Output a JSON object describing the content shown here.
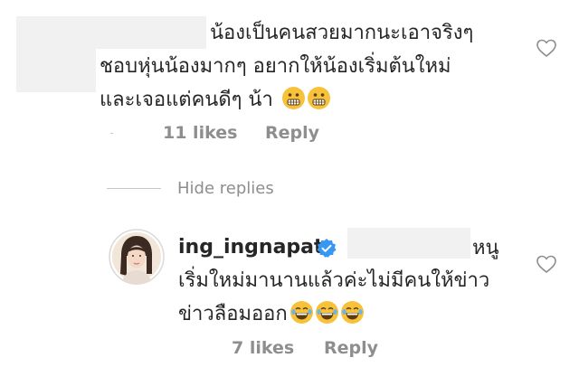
{
  "comment": {
    "line1": "น้องเป็นคนสวยมากนะเอาจริงๆ",
    "line2": "ชอบหุ่นน้องมากๆ  อยากให้น้องเริ่มต้นใหม่",
    "line3": "และเจอแต่คนดีๆ น้า",
    "likes": "11 likes",
    "reply_label": "Reply",
    "emojis": [
      "grimacing-face-emoji",
      "grimacing-face-emoji"
    ]
  },
  "hide_replies_label": "Hide replies",
  "reply": {
    "username": "ing_ingnapat",
    "verified": true,
    "line1_suffix": "หนู",
    "line2": "เริ่มใหม่มานานแล้วค่ะไม่มีคนให้ข่าว",
    "line3": "ข่าวลือมออก",
    "likes": "7 likes",
    "reply_label": "Reply",
    "emojis": [
      "laughing-tears-emoji",
      "laughing-tears-emoji",
      "laughing-tears-emoji"
    ]
  },
  "colors": {
    "text": "#262626",
    "muted": "#8e8e8e",
    "verified": "#3897f0",
    "redaction": "#f1f1f1"
  },
  "icons": {
    "like": "heart-outline-icon"
  }
}
